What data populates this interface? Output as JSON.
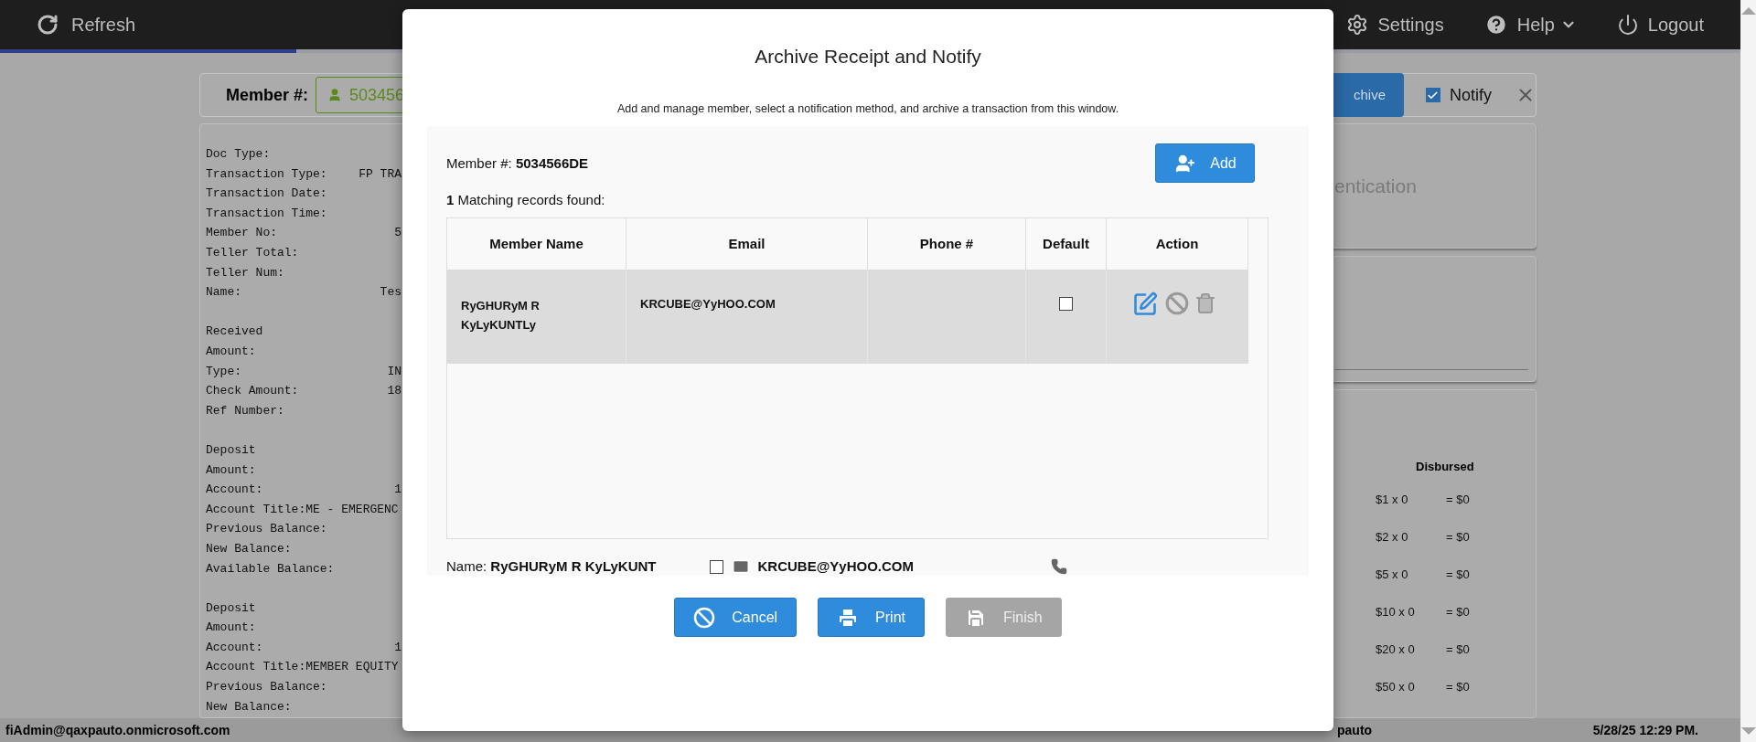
{
  "top_bar": {
    "refresh": "Refresh",
    "menu": [
      {
        "kind": "settings",
        "label": "Settings"
      },
      {
        "kind": "help",
        "label": "Help"
      },
      {
        "kind": "logout",
        "label": "Logout"
      }
    ]
  },
  "progress": {
    "level": 0.17
  },
  "member_bar": {
    "label": "Member #:",
    "value": "503456",
    "archive_button": "chive",
    "notify": {
      "label": "Notify",
      "checked": true
    }
  },
  "receipt": {
    "sections": [
      {
        "lines": [
          {
            "label": "Doc Type:"
          },
          {
            "label": "Transaction Type:",
            "value": "FP TRA"
          },
          {
            "label": "Transaction Date:"
          },
          {
            "label": "Transaction Time:"
          },
          {
            "label": "Member No:",
            "value": "5"
          },
          {
            "label": "Teller Total:"
          },
          {
            "label": "Teller Num:"
          },
          {
            "label": "Name:",
            "value": "Tes"
          }
        ]
      },
      {
        "lines": [
          {
            "label": "Received"
          },
          {
            "label": "Amount:"
          },
          {
            "label": "Type:",
            "value": "IN"
          },
          {
            "label": "Check Amount:",
            "value": "18"
          },
          {
            "label": "Ref Number:"
          }
        ]
      },
      {
        "lines": [
          {
            "label": "Deposit"
          },
          {
            "label": "Amount:"
          },
          {
            "label": "Account:",
            "value": "1"
          },
          {
            "label": "Account Title:ME - EMERGENC"
          },
          {
            "label": "Previous Balance:"
          },
          {
            "label": "New Balance:"
          },
          {
            "label": "Available Balance:"
          }
        ]
      },
      {
        "lines": [
          {
            "label": "Deposit"
          },
          {
            "label": "Amount:"
          },
          {
            "label": "Account:",
            "value": "1"
          },
          {
            "label": "Account Title:MEMBER EQUITY"
          },
          {
            "label": "Previous Balance:"
          },
          {
            "label": "New Balance:"
          }
        ]
      }
    ]
  },
  "right_cards": {
    "title": "entication",
    "disbursed": {
      "heading": "Disbursed",
      "rows": [
        {
          "denomination": "$1 x 0",
          "total": "= $0"
        },
        {
          "denomination": "$2 x 0",
          "total": "= $0"
        },
        {
          "denomination": "$5 x 0",
          "total": "= $0"
        },
        {
          "denomination": "$10 x 0",
          "total": "= $0"
        },
        {
          "denomination": "$20 x 0",
          "total": "= $0"
        },
        {
          "denomination": "$50 x 0",
          "total": "= $0"
        }
      ]
    }
  },
  "modal": {
    "title": "Archive Receipt and Notify",
    "subtitle": "Add and manage member, select a notification method, and archive a transaction from this window.",
    "member_label": "Member #:",
    "member_number": "5034566DE",
    "add_button": "Add",
    "match_count": "1",
    "match_text": "Matching records found:",
    "columns": [
      "Member Name",
      "Email",
      "Phone #",
      "Default",
      "Action"
    ],
    "rows": [
      {
        "name": "RyGHURyM R KyLyKUNTLy",
        "email": "KRCUBE@YyHOO.COM",
        "default": false,
        "selected": true
      }
    ],
    "contact": {
      "name_label": "Name:",
      "name": "RyGHURyM R KyLyKUNT",
      "email_checked": false,
      "email": "KRCUBE@YyHOO.COM"
    },
    "buttons": [
      {
        "kind": "cancel",
        "label": "Cancel",
        "disabled": false
      },
      {
        "kind": "print",
        "label": "Print",
        "disabled": false
      },
      {
        "kind": "finish",
        "label": "Finish",
        "disabled": true
      }
    ]
  },
  "status_bar": {
    "user": "fiAdmin@qaxpauto.onmicrosoft.com",
    "middle": "pauto",
    "datetime": "5/28/25 12:29 PM."
  }
}
